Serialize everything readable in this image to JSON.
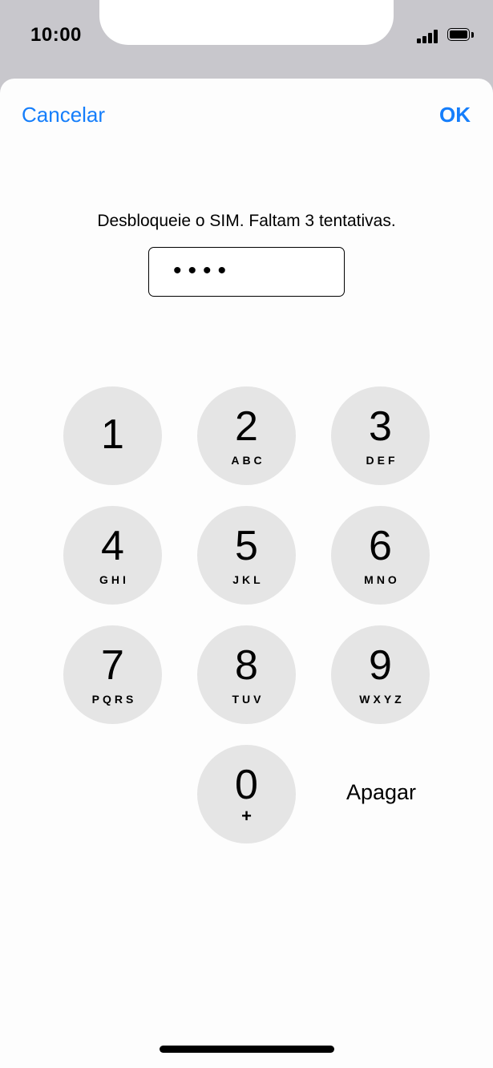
{
  "status": {
    "time": "10:00"
  },
  "nav": {
    "cancel_label": "Cancelar",
    "ok_label": "OK"
  },
  "prompt": {
    "text": "Desbloqueie o SIM. Faltam 3 tentativas."
  },
  "pin": {
    "masked_value": "••••"
  },
  "keypad": {
    "keys": [
      {
        "digit": "1",
        "letters": ""
      },
      {
        "digit": "2",
        "letters": "ABC"
      },
      {
        "digit": "3",
        "letters": "DEF"
      },
      {
        "digit": "4",
        "letters": "GHI"
      },
      {
        "digit": "5",
        "letters": "JKL"
      },
      {
        "digit": "6",
        "letters": "MNO"
      },
      {
        "digit": "7",
        "letters": "PQRS"
      },
      {
        "digit": "8",
        "letters": "TUV"
      },
      {
        "digit": "9",
        "letters": "WXYZ"
      },
      {
        "digit": "0",
        "letters": "+"
      }
    ],
    "delete_label": "Apagar"
  },
  "colors": {
    "accent": "#157efb",
    "key_background": "#e5e5e5",
    "status_background": "#c8c7cc"
  }
}
